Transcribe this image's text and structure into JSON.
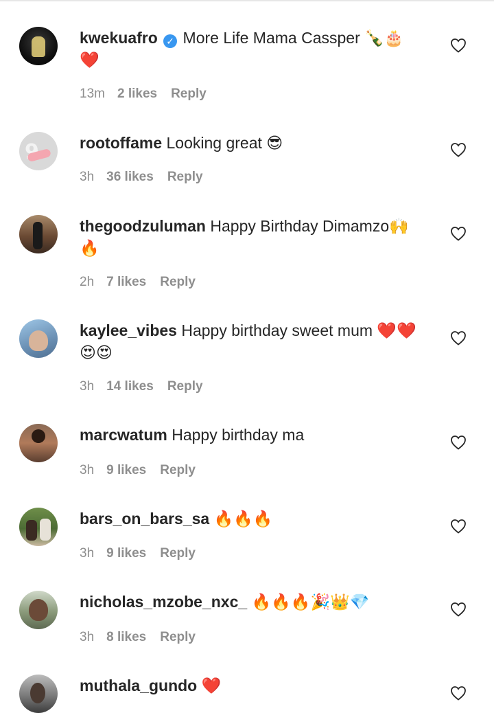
{
  "heart_icon": "heart-outline-icon",
  "comments": [
    {
      "username": "kwekuafro",
      "verified": true,
      "text": "More Life Mama Cassper 🍾🎂",
      "text2": "❤️",
      "time": "13m",
      "likes": "2 likes",
      "reply": "Reply"
    },
    {
      "username": "rootoffame",
      "verified": false,
      "text": "Looking great 😎",
      "text2": "",
      "time": "3h",
      "likes": "36 likes",
      "reply": "Reply"
    },
    {
      "username": "thegoodzuluman",
      "verified": false,
      "text": "Happy Birthday Dimamzo🙌",
      "text2": "🔥",
      "time": "2h",
      "likes": "7 likes",
      "reply": "Reply"
    },
    {
      "username": "kaylee_vibes",
      "verified": false,
      "text": "Happy birthday sweet mum ❤️❤️",
      "text2": "😍😍",
      "time": "3h",
      "likes": "14 likes",
      "reply": "Reply"
    },
    {
      "username": "marcwatum",
      "verified": false,
      "text": "Happy birthday ma",
      "text2": "",
      "time": "3h",
      "likes": "9 likes",
      "reply": "Reply"
    },
    {
      "username": "bars_on_bars_sa",
      "verified": false,
      "text": "🔥🔥🔥",
      "text2": "",
      "time": "3h",
      "likes": "9 likes",
      "reply": "Reply"
    },
    {
      "username": "nicholas_mzobe_nxc_",
      "verified": false,
      "text": "🔥🔥🔥🎉👑💎",
      "text2": "",
      "time": "3h",
      "likes": "8 likes",
      "reply": "Reply"
    },
    {
      "username": "muthala_gundo",
      "verified": false,
      "text": "❤️",
      "text2": "",
      "time": "",
      "likes": "",
      "reply": ""
    }
  ]
}
